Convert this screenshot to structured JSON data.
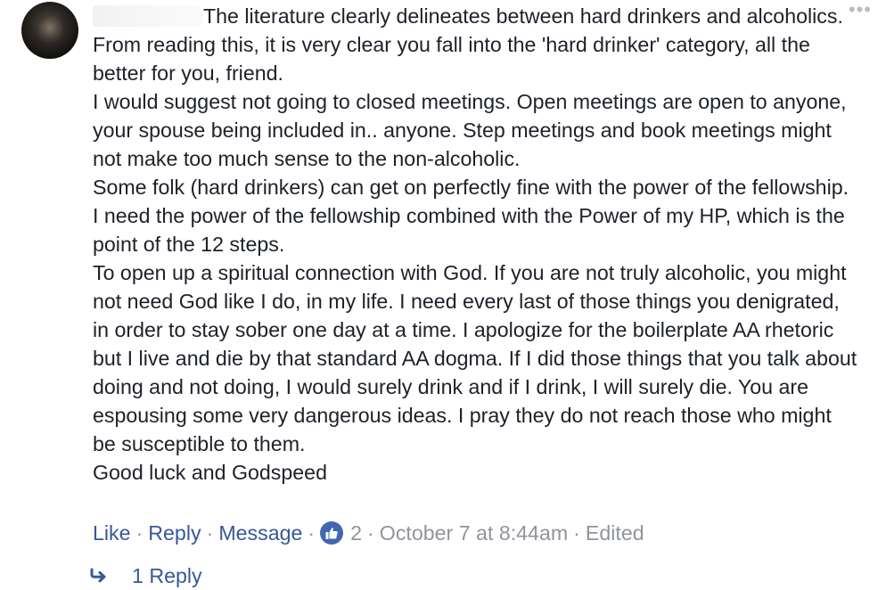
{
  "comment": {
    "more_label": "•••",
    "paragraphs": [
      "The literature clearly delineates between hard drinkers and alcoholics.",
      "From reading this, it is very clear you fall into the 'hard drinker' category, all the better for you, friend.",
      "I would suggest not going to closed meetings. Open meetings are open to anyone, your spouse being included in.. anyone. Step meetings and book meetings might not make too much sense to the non-alcoholic.",
      "Some folk (hard drinkers) can get on perfectly fine with the power of the fellowship. I need the power of the fellowship combined with the Power of my HP, which is the point of the 12 steps.",
      "To open up a spiritual connection with God. If you are not truly alcoholic, you might not need God like I do, in my life. I need every last of those things you denigrated, in order to stay sober one day at a time. I apologize for the boilerplate AA rhetoric but I live and die by that standard AA dogma. If I did those things that you talk about doing and not doing, I would surely drink and if I drink, I will surely die. You are espousing some very dangerous ideas. I pray they do not reach those who might be susceptible to them.",
      "Good luck and Godspeed"
    ],
    "actions": {
      "like_label": "Like",
      "reply_label": "Reply",
      "message_label": "Message",
      "sep": "·",
      "reaction_count": "2",
      "timestamp": "October 7 at 8:44am",
      "edited_label": "Edited"
    },
    "replies_label": "1 Reply",
    "colors": {
      "link": "#385898",
      "meta": "#90949c",
      "text": "#1d2129",
      "like_badge": "#4267b2"
    },
    "icons": {
      "reaction": "thumbs-up-icon",
      "replies": "reply-arrow-icon",
      "menu": "more-options-icon"
    }
  }
}
